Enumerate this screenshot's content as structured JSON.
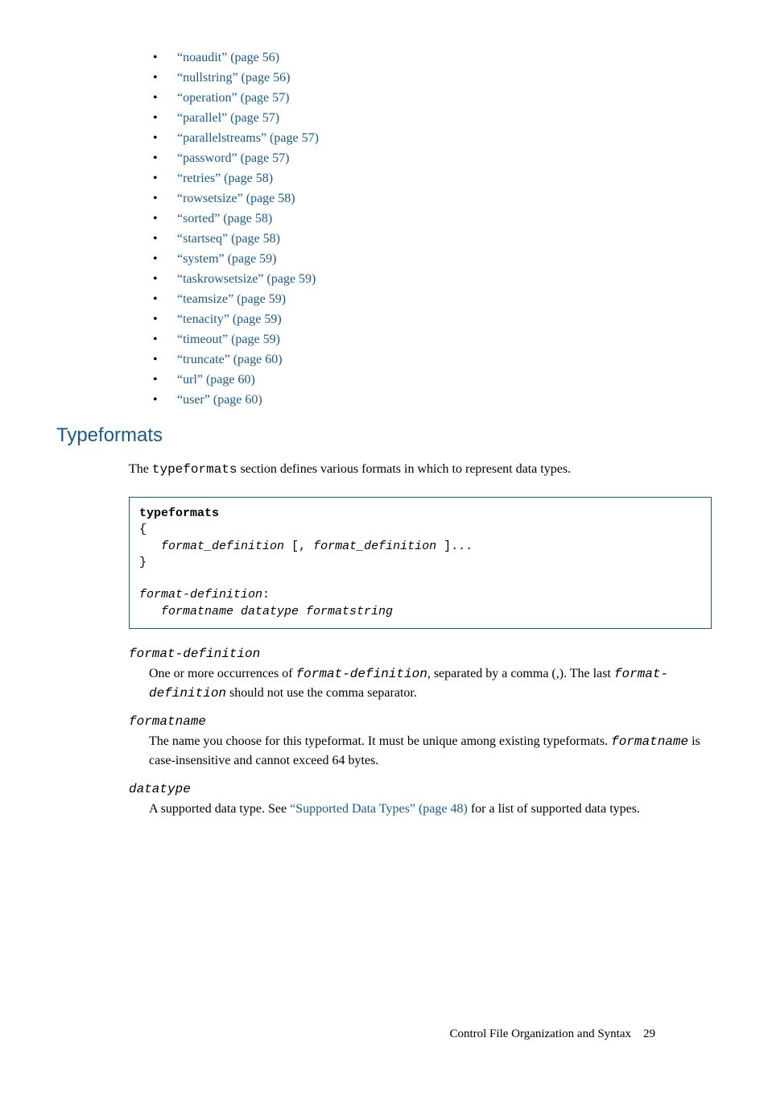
{
  "bullets": [
    {
      "label": "“noaudit” (page 56)"
    },
    {
      "label": "“nullstring” (page 56)"
    },
    {
      "label": "“operation” (page 57)"
    },
    {
      "label": "“parallel” (page 57)"
    },
    {
      "label": "“parallelstreams” (page 57)"
    },
    {
      "label": "“password” (page 57)"
    },
    {
      "label": "“retries” (page 58)"
    },
    {
      "label": "“rowsetsize” (page 58)"
    },
    {
      "label": "“sorted” (page 58)"
    },
    {
      "label": "“startseq” (page 58)"
    },
    {
      "label": "“system” (page 59)"
    },
    {
      "label": "“taskrowsetsize” (page 59)"
    },
    {
      "label": "“teamsize” (page 59)"
    },
    {
      "label": "“tenacity” (page 59)"
    },
    {
      "label": "“timeout” (page 59)"
    },
    {
      "label": "“truncate” (page 60)"
    },
    {
      "label": "“url” (page 60)"
    },
    {
      "label": "“user” (page 60)"
    }
  ],
  "heading": "Typeformats",
  "intro": {
    "part1": "The ",
    "mono1": "typeformats",
    "part2": " section defines various formats in which to represent data types."
  },
  "codebox": {
    "l1": "typeformats",
    "l2": "{",
    "l3a": "   ",
    "l3b": "format_definition",
    "l3c": " [, ",
    "l3d": "format_definition",
    "l3e": " ]...",
    "l4": "}",
    "l5": "",
    "l6a": "format-definition",
    "l6b": ":",
    "l7a": "   ",
    "l7b": "formatname datatype formatstring"
  },
  "defs": {
    "t1": "format-definition",
    "b1a": "One or more occurrences of ",
    "b1b": "format-definition",
    "b1c": ", separated by a comma (,). The last ",
    "b1d": "format-definition",
    "b1e": " should not use the comma separator.",
    "t2": "formatname",
    "b2a": "The name you choose for this typeformat. It must be unique among existing typeformats. ",
    "b2b": "formatname",
    "b2c": " is case-insensitive and cannot exceed 64 bytes.",
    "t3": "datatype",
    "b3a": "A supported data type. See ",
    "b3b": "“Supported Data Types” (page 48)",
    "b3c": " for a list of supported data types."
  },
  "footer": {
    "text": "Control File Organization and Syntax",
    "page": "29"
  }
}
